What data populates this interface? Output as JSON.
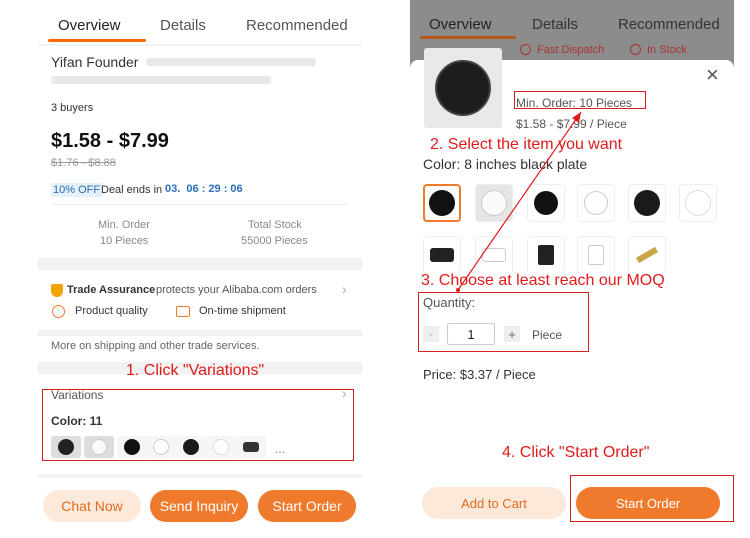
{
  "left": {
    "tabs": [
      "Overview",
      "Details",
      "Recommended"
    ],
    "product_title_prefix": "Yifan Founder",
    "buyers": "3 buyers",
    "price_range": "$1.58 - $7.99",
    "old_price": "$1.76 - $8.88",
    "discount_badge": "10% OFF",
    "deal_ends_label": "Deal ends in",
    "deal_timer": "03.  06 : 29 : 06",
    "min_order_label": "Min. Order",
    "min_order_value": "10 Pieces",
    "total_stock_label": "Total Stock",
    "total_stock_value": "55000 Pieces",
    "trade_assurance_title": "Trade Assurance",
    "trade_assurance_text": "protects your Alibaba.com orders",
    "product_quality": "Product quality",
    "on_time_shipment": "On-time shipment",
    "more_shipping": "More on shipping and other trade services.",
    "variations_label": "Variations",
    "color_count": "Color: 11",
    "ellipsis": "...",
    "chat_now": "Chat Now",
    "send_inquiry": "Send Inquiry",
    "start_order": "Start Order"
  },
  "right": {
    "tabs": [
      "Overview",
      "Details",
      "Recommended"
    ],
    "fast_dispatch": "Fast Dispatch",
    "in_stock": "In Stock",
    "close": "×",
    "min_order": "Min. Order: 10 Pieces",
    "price_range": "$1.58 - $7.99 / Piece",
    "color_selected": "Color: 8 inches black plate",
    "quantity_label": "Quantity:",
    "quantity_value": "1",
    "unit": "Piece",
    "minus": "-",
    "plus": "+",
    "price": "Price: $3.37 / Piece",
    "add_to_cart": "Add to Cart",
    "start_order": "Start Order"
  },
  "annotations": {
    "step1": "1. Click \"Variations\"",
    "step2": "2. Select the item you want",
    "step3": "3. Choose at least reach our MOQ",
    "step4": "4. Click \"Start Order\""
  },
  "colors": {
    "accent": "#ff6a00",
    "annotation": "#e01b1b",
    "button_orange": "#f07a2c",
    "button_light": "#fde9d9"
  }
}
